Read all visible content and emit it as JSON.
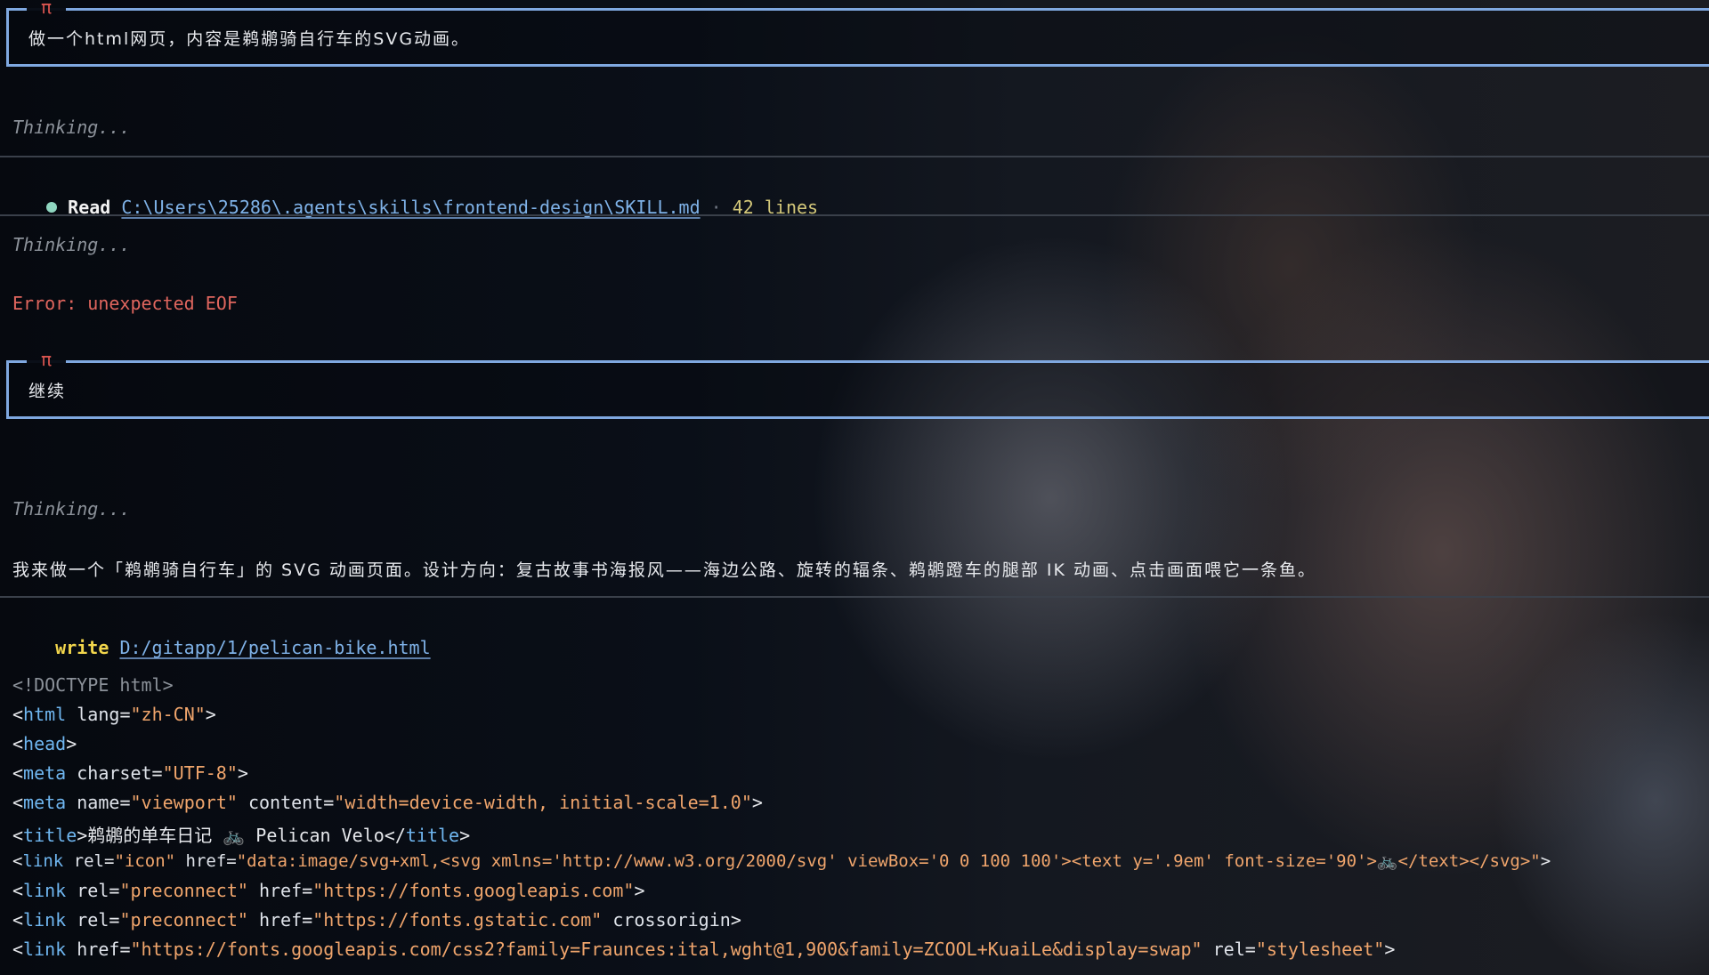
{
  "prompts": [
    {
      "symbol": "π",
      "text": "做一个html网页，内容是鹈鹕骑自行车的SVG动画。"
    },
    {
      "symbol": "π",
      "text": "继续"
    }
  ],
  "thinking_label": "Thinking...",
  "read_entry": {
    "label": "Read",
    "path": "C:\\Users\\25286\\.agents\\skills\\frontend-design\\SKILL.md",
    "separator": "·",
    "meta": "42 lines"
  },
  "error_text": "Error: unexpected EOF",
  "assistant_message": "我来做一个「鹈鹕骑自行车」的 SVG 动画页面。设计方向：复古故事书海报风——海边公路、旋转的辐条、鹈鹕蹬车的腿部 IK 动画、点击画面喂它一条鱼。",
  "write_entry": {
    "label": "write",
    "path": "D:/gitapp/1/pelican-bike.html"
  },
  "code": {
    "doctype": "<!DOCTYPE html>",
    "l1": {
      "open": "<",
      "tag": "html",
      "attr": " lang",
      "eq": "=",
      "val": "\"zh-CN\"",
      "close": ">"
    },
    "l2": {
      "open": "<",
      "tag": "head",
      "close": ">"
    },
    "l3": {
      "open": "<",
      "tag": "meta",
      "attr": " charset",
      "eq": "=",
      "val": "\"UTF-8\"",
      "close": ">"
    },
    "l4": {
      "open": "<",
      "tag": "meta",
      "attr1": " name",
      "val1": "\"viewport\"",
      "attr2": " content",
      "val2": "\"width=device-width, initial-scale=1.0\"",
      "close": ">"
    },
    "l5": {
      "open": "<",
      "tag": "title",
      "text": ">鹈鹕的单车日记 🚲 Pelican Velo</",
      "tag2": "title",
      "close": ">"
    },
    "l6": {
      "open": "<",
      "tag": "link",
      "attr1": " rel",
      "val1": "\"icon\"",
      "attr2": " href",
      "val2": "\"data:image/svg+xml,<svg xmlns='http://www.w3.org/2000/svg' viewBox='0 0 100 100'><text y='.9em' font-size='90'>🚲</text></svg>\"",
      "close": ">"
    },
    "l7": {
      "open": "<",
      "tag": "link",
      "attr1": " rel",
      "val1": "\"preconnect\"",
      "attr2": " href",
      "val2": "\"https://fonts.googleapis.com\"",
      "close": ">"
    },
    "l8": {
      "open": "<",
      "tag": "link",
      "attr1": " rel",
      "val1": "\"preconnect\"",
      "attr2": " href",
      "val2": "\"https://fonts.gstatic.com\"",
      "attr3": " crossorigin",
      "close": ">"
    },
    "l9": {
      "open": "<",
      "tag": "link",
      "attr1": " href",
      "val1": "\"https://fonts.googleapis.com/css2?family=Fraunces:ital,wght@1,900&family=ZCOOL+KuaiLe&display=swap\"",
      "attr2": " rel",
      "val2": "\"stylesheet\"",
      "close": ">"
    }
  }
}
